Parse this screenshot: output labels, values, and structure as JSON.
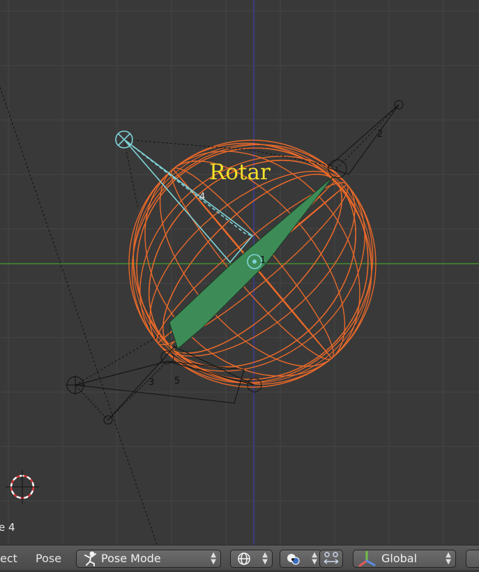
{
  "viewport": {
    "overlay_label": "Rotar",
    "object_label": "e 4",
    "bone_numbers": [
      "4",
      "2",
      "1",
      "3",
      "5"
    ],
    "colors": {
      "background": "#393939",
      "grid": "#454545",
      "x_axis": "#3f8f2f",
      "y_axis": "#3a3a9a",
      "sphere_wire": "#e8692a",
      "selected_bone": "#7fd4d8",
      "active_bone_fill": "#3d8c57",
      "overlay_text": "#f4df2a"
    }
  },
  "header": {
    "select_menu": "ect",
    "pose_menu": "Pose",
    "mode_selector": {
      "value": "Pose Mode",
      "icon": "pose-figure-icon"
    },
    "viewport_shading": {
      "icon": "globe-icon"
    },
    "pivot_point": {
      "icon": "pivot-icon"
    },
    "manipulator": {
      "icon": "manipulator-icon"
    },
    "orientation": {
      "value": "Global",
      "icon": "transform-axes-icon"
    }
  }
}
